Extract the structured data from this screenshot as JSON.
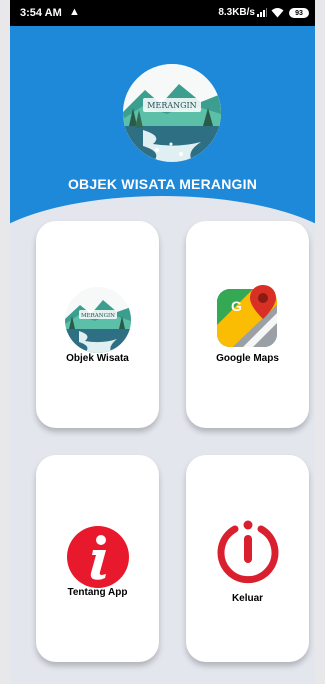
{
  "status_bar": {
    "time": "3:54 AM",
    "speed": "8.3KB/s",
    "battery": "93"
  },
  "header": {
    "title": "OBJEK WISATA MERANGIN",
    "logo_text": "MERANGIN"
  },
  "menu": [
    {
      "label": "Objek Wisata",
      "icon": "merangin-logo-icon"
    },
    {
      "label": "Google Maps",
      "icon": "google-maps-icon"
    },
    {
      "label": "Tentang App",
      "icon": "info-icon"
    },
    {
      "label": "Keluar",
      "icon": "power-icon"
    }
  ],
  "colors": {
    "header_blue": "#1e88d9",
    "background": "#e3e6ed",
    "info_red": "#e8192c",
    "power_red": "#d9202e"
  }
}
